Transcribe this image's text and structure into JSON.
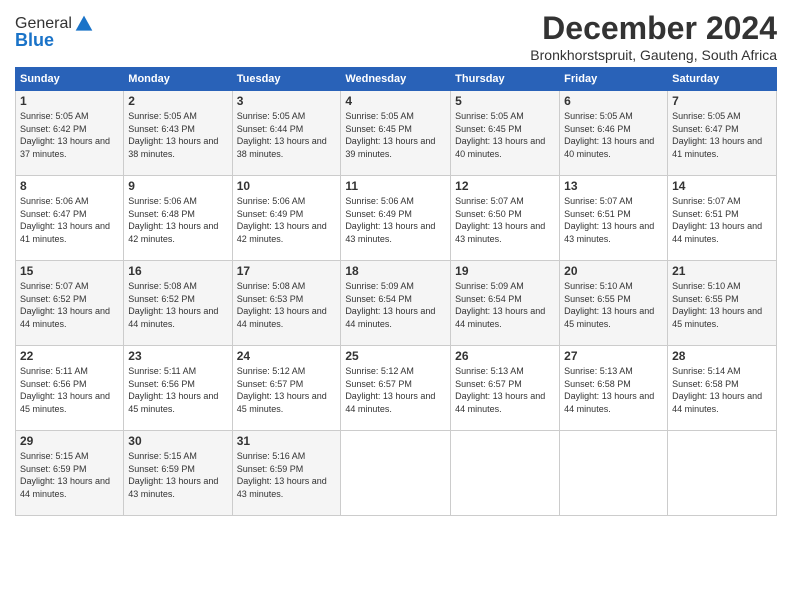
{
  "logo": {
    "general": "General",
    "blue": "Blue"
  },
  "header": {
    "month": "December 2024",
    "location": "Bronkhorstspruit, Gauteng, South Africa"
  },
  "days_header": [
    "Sunday",
    "Monday",
    "Tuesday",
    "Wednesday",
    "Thursday",
    "Friday",
    "Saturday"
  ],
  "weeks": [
    [
      {
        "day": "1",
        "sunrise": "5:05 AM",
        "sunset": "6:42 PM",
        "daylight": "13 hours and 37 minutes."
      },
      {
        "day": "2",
        "sunrise": "5:05 AM",
        "sunset": "6:43 PM",
        "daylight": "13 hours and 38 minutes."
      },
      {
        "day": "3",
        "sunrise": "5:05 AM",
        "sunset": "6:44 PM",
        "daylight": "13 hours and 38 minutes."
      },
      {
        "day": "4",
        "sunrise": "5:05 AM",
        "sunset": "6:45 PM",
        "daylight": "13 hours and 39 minutes."
      },
      {
        "day": "5",
        "sunrise": "5:05 AM",
        "sunset": "6:45 PM",
        "daylight": "13 hours and 40 minutes."
      },
      {
        "day": "6",
        "sunrise": "5:05 AM",
        "sunset": "6:46 PM",
        "daylight": "13 hours and 40 minutes."
      },
      {
        "day": "7",
        "sunrise": "5:05 AM",
        "sunset": "6:47 PM",
        "daylight": "13 hours and 41 minutes."
      }
    ],
    [
      {
        "day": "8",
        "sunrise": "5:06 AM",
        "sunset": "6:47 PM",
        "daylight": "13 hours and 41 minutes."
      },
      {
        "day": "9",
        "sunrise": "5:06 AM",
        "sunset": "6:48 PM",
        "daylight": "13 hours and 42 minutes."
      },
      {
        "day": "10",
        "sunrise": "5:06 AM",
        "sunset": "6:49 PM",
        "daylight": "13 hours and 42 minutes."
      },
      {
        "day": "11",
        "sunrise": "5:06 AM",
        "sunset": "6:49 PM",
        "daylight": "13 hours and 43 minutes."
      },
      {
        "day": "12",
        "sunrise": "5:07 AM",
        "sunset": "6:50 PM",
        "daylight": "13 hours and 43 minutes."
      },
      {
        "day": "13",
        "sunrise": "5:07 AM",
        "sunset": "6:51 PM",
        "daylight": "13 hours and 43 minutes."
      },
      {
        "day": "14",
        "sunrise": "5:07 AM",
        "sunset": "6:51 PM",
        "daylight": "13 hours and 44 minutes."
      }
    ],
    [
      {
        "day": "15",
        "sunrise": "5:07 AM",
        "sunset": "6:52 PM",
        "daylight": "13 hours and 44 minutes."
      },
      {
        "day": "16",
        "sunrise": "5:08 AM",
        "sunset": "6:52 PM",
        "daylight": "13 hours and 44 minutes."
      },
      {
        "day": "17",
        "sunrise": "5:08 AM",
        "sunset": "6:53 PM",
        "daylight": "13 hours and 44 minutes."
      },
      {
        "day": "18",
        "sunrise": "5:09 AM",
        "sunset": "6:54 PM",
        "daylight": "13 hours and 44 minutes."
      },
      {
        "day": "19",
        "sunrise": "5:09 AM",
        "sunset": "6:54 PM",
        "daylight": "13 hours and 44 minutes."
      },
      {
        "day": "20",
        "sunrise": "5:10 AM",
        "sunset": "6:55 PM",
        "daylight": "13 hours and 45 minutes."
      },
      {
        "day": "21",
        "sunrise": "5:10 AM",
        "sunset": "6:55 PM",
        "daylight": "13 hours and 45 minutes."
      }
    ],
    [
      {
        "day": "22",
        "sunrise": "5:11 AM",
        "sunset": "6:56 PM",
        "daylight": "13 hours and 45 minutes."
      },
      {
        "day": "23",
        "sunrise": "5:11 AM",
        "sunset": "6:56 PM",
        "daylight": "13 hours and 45 minutes."
      },
      {
        "day": "24",
        "sunrise": "5:12 AM",
        "sunset": "6:57 PM",
        "daylight": "13 hours and 45 minutes."
      },
      {
        "day": "25",
        "sunrise": "5:12 AM",
        "sunset": "6:57 PM",
        "daylight": "13 hours and 44 minutes."
      },
      {
        "day": "26",
        "sunrise": "5:13 AM",
        "sunset": "6:57 PM",
        "daylight": "13 hours and 44 minutes."
      },
      {
        "day": "27",
        "sunrise": "5:13 AM",
        "sunset": "6:58 PM",
        "daylight": "13 hours and 44 minutes."
      },
      {
        "day": "28",
        "sunrise": "5:14 AM",
        "sunset": "6:58 PM",
        "daylight": "13 hours and 44 minutes."
      }
    ],
    [
      {
        "day": "29",
        "sunrise": "5:15 AM",
        "sunset": "6:59 PM",
        "daylight": "13 hours and 44 minutes."
      },
      {
        "day": "30",
        "sunrise": "5:15 AM",
        "sunset": "6:59 PM",
        "daylight": "13 hours and 43 minutes."
      },
      {
        "day": "31",
        "sunrise": "5:16 AM",
        "sunset": "6:59 PM",
        "daylight": "13 hours and 43 minutes."
      },
      null,
      null,
      null,
      null
    ]
  ]
}
